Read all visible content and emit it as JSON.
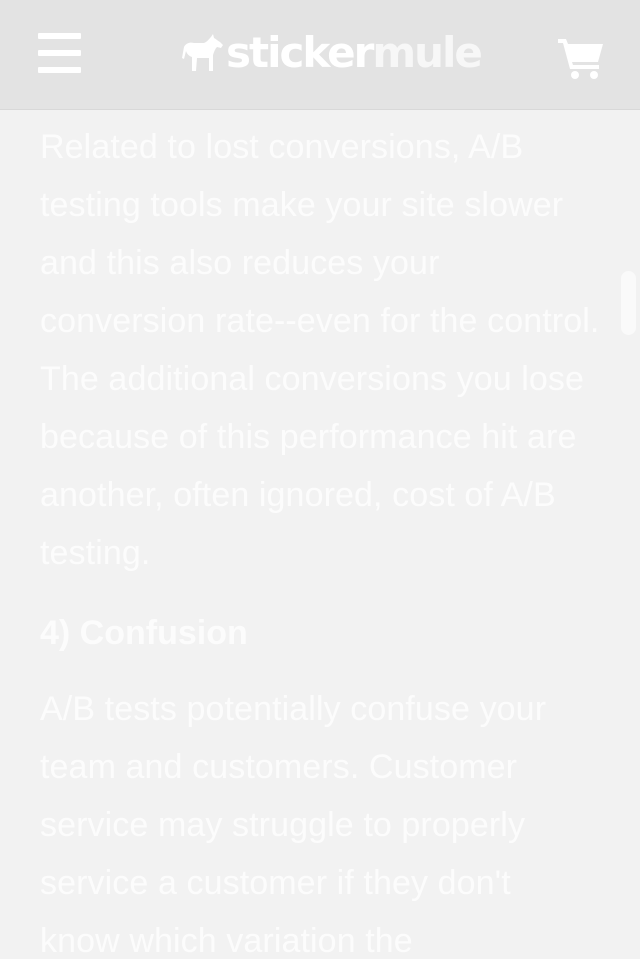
{
  "header": {
    "menu_icon": "hamburger-menu-icon",
    "logo_icon": "mule-icon",
    "logo_part1": "sticker",
    "logo_part2": "mule",
    "cart_icon": "shopping-cart-icon"
  },
  "article": {
    "paragraph_1": "Related to lost conversions, A/B testing tools make your site slower and this also reduces your conversion rate--even for the control. The additional conversions you lose because of this performance hit are another, often ignored, cost of A/B testing.",
    "heading": "4) Confusion",
    "paragraph_2": "A/B tests potentially confuse your team and customers. Customer service may struggle to properly service a customer if they don't know which variation the"
  },
  "colors": {
    "header_bg": "#e3e3e3",
    "page_bg": "#f2f2f2",
    "text": "#fcfcfc"
  }
}
